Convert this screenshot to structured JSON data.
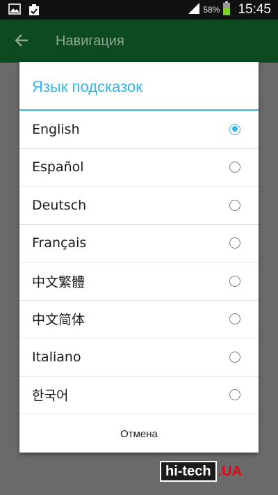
{
  "status_bar": {
    "icons_left": [
      "image-icon",
      "clipboard-check-icon"
    ],
    "icons_right": [
      "signal-icon",
      "battery-icon"
    ],
    "battery_percent": "58%",
    "time": "15:45"
  },
  "app_bar": {
    "title": "Навигация",
    "back_icon": "arrow-back-icon"
  },
  "dialog": {
    "title": "Язык подсказок",
    "options": [
      {
        "label": "English",
        "selected": true
      },
      {
        "label": "Español",
        "selected": false
      },
      {
        "label": "Deutsch",
        "selected": false
      },
      {
        "label": "Français",
        "selected": false
      },
      {
        "label": "中文繁體",
        "selected": false
      },
      {
        "label": "中文简体",
        "selected": false
      },
      {
        "label": "Italiano",
        "selected": false
      },
      {
        "label": "한국어",
        "selected": false
      }
    ],
    "cancel_label": "Отмена"
  },
  "watermark": {
    "brand": "hi-tech",
    "suffix": ".UA"
  },
  "colors": {
    "accent": "#33b5e5",
    "app_bar_dimmed": "#0c4a1f",
    "status_bar": "#111111"
  }
}
